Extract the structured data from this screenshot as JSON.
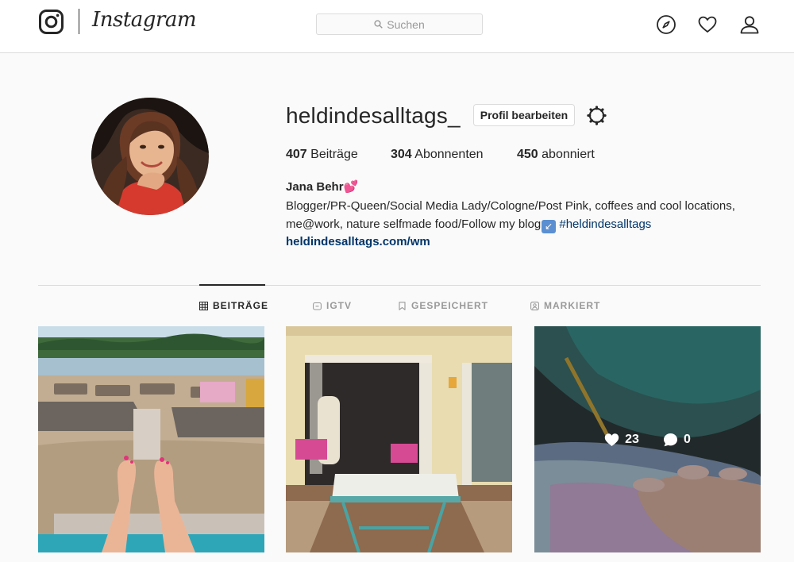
{
  "brand": {
    "wordmark": "Instagram"
  },
  "search": {
    "placeholder": "Suchen"
  },
  "nav": {
    "icons": [
      "compass-icon",
      "heart-icon",
      "person-icon"
    ]
  },
  "profile": {
    "username": "heldindesalltags_",
    "edit_label": "Profil bearbeiten",
    "stats": {
      "posts_count": "407",
      "posts_label": "Beiträge",
      "followers_count": "304",
      "followers_label": "Abonnenten",
      "following_count": "450",
      "following_label": "abonniert"
    },
    "full_name": "Jana Behr",
    "full_name_emoji": "💕",
    "bio_line1": "Blogger/PR-Queen/Social Media Lady/Cologne/Post Pink, coffees and cool locations,",
    "bio_line2": "me@work, nature selfmade food/Follow my blog",
    "bio_arrow": "↙",
    "bio_hashtag": "#heldindesalltags",
    "website": "heldindesalltags.com/wm"
  },
  "tabs": [
    {
      "label": "BEITRÄGE",
      "icon": "grid-icon",
      "active": true
    },
    {
      "label": "IGTV",
      "icon": "igtv-icon",
      "active": false
    },
    {
      "label": "GESPEICHERT",
      "icon": "bookmark-icon",
      "active": false
    },
    {
      "label": "MARKIERT",
      "icon": "tag-person-icon",
      "active": false
    }
  ],
  "posts": [
    {
      "subject": "beach-lounger-feet-photo"
    },
    {
      "subject": "cafe-terrace-photo"
    },
    {
      "subject": "iridescent-bag-hand-photo",
      "hover": {
        "likes": "23",
        "comments": "0"
      }
    }
  ],
  "colors": {
    "link": "#003569",
    "border": "#dbdbdb",
    "text": "#262626",
    "muted": "#999999"
  }
}
